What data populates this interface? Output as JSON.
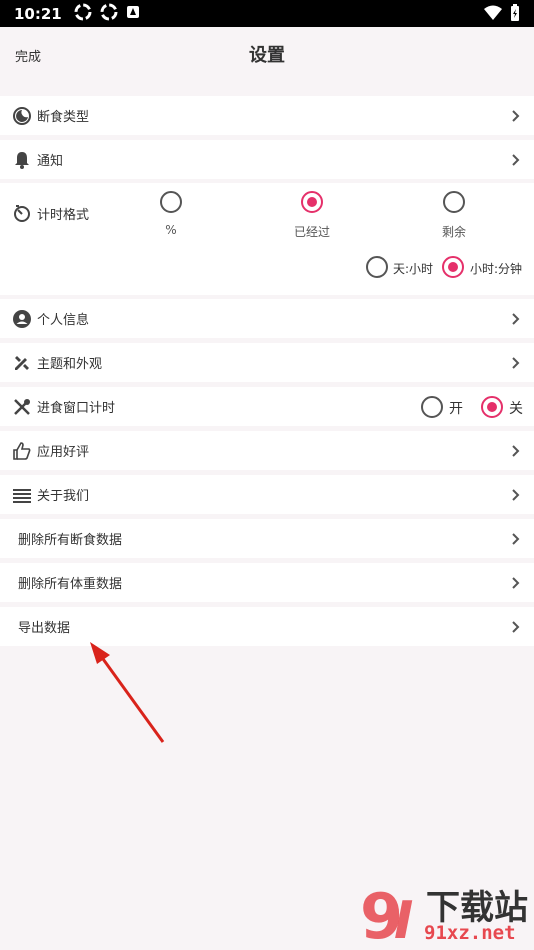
{
  "status": {
    "time": "10:21"
  },
  "header": {
    "done_label": "完成",
    "title": "设置"
  },
  "rows": {
    "fasting_type": "断食类型",
    "notification": "通知",
    "profile": "个人信息",
    "theme": "主题和外观",
    "eating_window": "进食窗口计时",
    "rate": "应用好评",
    "about": "关于我们",
    "delete_fasting": "删除所有断食数据",
    "delete_weight": "删除所有体重数据",
    "export": "导出数据"
  },
  "timer_format": {
    "label": "计时格式",
    "options": [
      "%",
      "已经过",
      "剩余"
    ],
    "selected": "已经过",
    "units": [
      "天:小时",
      "小时:分钟"
    ],
    "selected_unit": "小时:分钟"
  },
  "eating_window_toggle": {
    "on_label": "开",
    "off_label": "关",
    "selected": "关"
  },
  "colors": {
    "accent": "#e5306a",
    "background": "#f8f4f6"
  },
  "watermark": {
    "text": "下载站",
    "domain": "91xz.net"
  }
}
